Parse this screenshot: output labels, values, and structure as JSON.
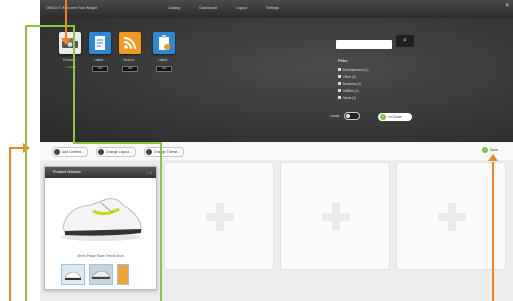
{
  "topbar": {
    "brand": "ORACLE Welcome Your Widget",
    "nav": [
      "Catalog",
      "Dashboard",
      "Logout",
      "Settings"
    ],
    "close": "×"
  },
  "widgets": [
    {
      "label": "Product...",
      "action": "✓ Added",
      "color": "#e9e9e9"
    },
    {
      "label": "Latest...",
      "action": "Add",
      "color": "#2f86d6"
    },
    {
      "label": "Search...",
      "action": "Add",
      "color": "#f39a1e"
    },
    {
      "label": "Latest...",
      "action": "Add",
      "color": "#2f86d6"
    }
  ],
  "search": {
    "placeholder": "",
    "go_icon": "search-icon"
  },
  "filter": {
    "title": "Filter",
    "items": [
      "Entertainment (1)",
      "Other (0)",
      "Business (2)",
      "Utilities (1)",
      "News (1)"
    ]
  },
  "locale_label": "Locale",
  "done_label": "I'm Done",
  "toolbar": {
    "add_content": "Add Content...",
    "change_layout": "Change Layout...",
    "change_theme": "Change Theme...",
    "save": "Save..."
  },
  "product_window": {
    "title": "Product Window",
    "controls": "– ×",
    "caption": "Men's Phase Racer Tennis Shoe"
  },
  "colors": {
    "annotation_orange": "#f58220",
    "annotation_green": "#8cc63f",
    "dark_panel": "#343434"
  }
}
